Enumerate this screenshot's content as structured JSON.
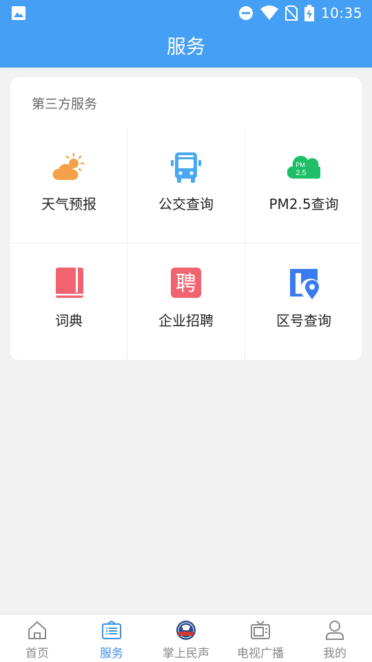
{
  "status_bar": {
    "time": "10:35"
  },
  "header": {
    "title": "服务"
  },
  "card": {
    "section_title": "第三方服务",
    "services": [
      {
        "label": "天气预报",
        "icon": "weather-icon"
      },
      {
        "label": "公交查询",
        "icon": "bus-icon"
      },
      {
        "label": "PM2.5查询",
        "icon": "pm25-cloud-icon",
        "icon_text_top": "PM",
        "icon_text_bottom": "2.5"
      },
      {
        "label": "词典",
        "icon": "dictionary-book-icon"
      },
      {
        "label": "企业招聘",
        "icon": "recruit-icon",
        "icon_text": "聘"
      },
      {
        "label": "区号查询",
        "icon": "area-code-location-icon"
      }
    ]
  },
  "tabs": [
    {
      "label": "首页",
      "icon": "home-icon",
      "active": false
    },
    {
      "label": "服务",
      "icon": "service-list-icon",
      "active": true
    },
    {
      "label": "掌上民声",
      "icon": "minsheng-logo-icon",
      "active": false
    },
    {
      "label": "电视广播",
      "icon": "tv-icon",
      "active": false
    },
    {
      "label": "我的",
      "icon": "user-icon",
      "active": false
    }
  ],
  "colors": {
    "brand": "#459ff4",
    "tab_active": "#3c8fe8",
    "tab_inactive": "#888888",
    "weather": "#f5a14a",
    "bus": "#4aa8f0",
    "pm25": "#1fbf6a",
    "dictionary": "#f06470",
    "recruit": "#f06470",
    "area_code": "#3a7bef"
  }
}
